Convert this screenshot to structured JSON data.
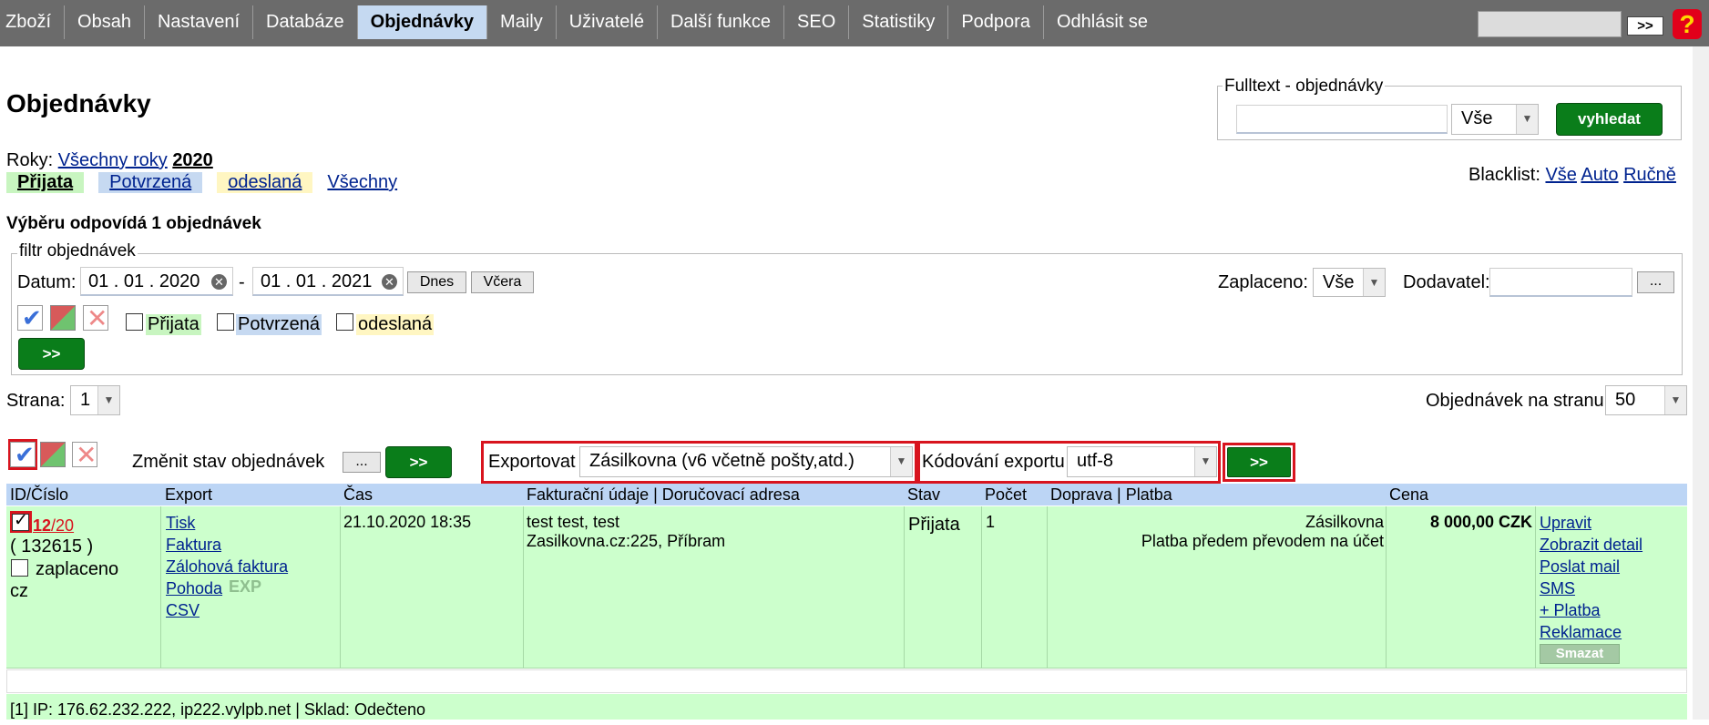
{
  "nav": {
    "items": [
      "Zboží",
      "Obsah",
      "Nastavení",
      "Databáze",
      "Objednávky",
      "Maily",
      "Uživatelé",
      "Další funkce",
      "SEO",
      "Statistiky",
      "Podpora",
      "Odhlásit se"
    ],
    "active": "Objednávky",
    "go_label": ">>",
    "help_label": "?"
  },
  "page_title": "Objednávky",
  "fulltext": {
    "legend": "Fulltext - objednávky",
    "query": "",
    "select_value": "Vše",
    "button_label": "vyhledat"
  },
  "years": {
    "label": "Roky:",
    "all_link": "Všechny roky",
    "current": "2020"
  },
  "status_links": {
    "prijata": "Přijata",
    "potvrzena": "Potvrzená",
    "odeslana": "odeslaná",
    "vsechny": "Všechny"
  },
  "blacklist": {
    "label": "Blacklist:",
    "vse": "Vše",
    "auto": "Auto",
    "rucne": "Ručně"
  },
  "result_count": "Výběru odpovídá 1 objednávek",
  "filter": {
    "legend": "filtr objednávek",
    "datum_label": "Datum:",
    "date_from": "01 . 01 . 2020",
    "date_sep": "-",
    "date_to": "01 . 01 . 2021",
    "dnes": "Dnes",
    "vcera": "Včera",
    "zaplaceno_label": "Zaplaceno:",
    "zaplaceno_value": "Vše",
    "dodavatel_label": "Dodavatel:",
    "dodavatel_value": "",
    "dodavatel_btn": "...",
    "status_prijata": "Přijata",
    "status_potvrzena": "Potvrzená",
    "status_odeslana": "odeslaná",
    "submit": ">>"
  },
  "paging": {
    "strana_label": "Strana:",
    "strana_value": "1",
    "per_page_label": "Objednávek na stranu:",
    "per_page_value": "50"
  },
  "bulk": {
    "change_state_label": "Změnit stav objednávek",
    "dots": "...",
    "go": ">>",
    "export_label": "Exportovat",
    "export_value": "Zásilkovna (v6 včetně pošty,atd.)",
    "encoding_label": "Kódování exportu",
    "encoding_value": "utf-8",
    "export_go": ">>"
  },
  "table": {
    "headers": [
      "ID/Číslo",
      "Export",
      "Čas",
      "Fakturační údaje | Doručovací adresa",
      "Stav",
      "Počet",
      "Doprava | Platba",
      "Cena"
    ],
    "row": {
      "order_no_a": "12",
      "order_no_b": "/20",
      "order_id": "( 132615 )",
      "paid_label": "zaplaceno",
      "lang": "cz",
      "export_links": [
        "Tisk",
        "Faktura",
        "Zálohová faktura",
        "Pohoda",
        "CSV"
      ],
      "exp_badge": "EXP",
      "time": "21.10.2020 18:35",
      "billing_line1": "test test, test",
      "billing_line2": "Zasilkovna.cz:225, Příbram",
      "state": "Přijata",
      "count": "1",
      "shipping": "Zásilkovna",
      "payment": "Platba předem převodem na účet",
      "price": "8 000,00 CZK",
      "actions": [
        "Upravit",
        "Zobrazit detail",
        "Poslat mail",
        "SMS",
        "+ Platba",
        "Reklamace"
      ],
      "delete_label": "Smazat",
      "footer": "[1]   IP: 176.62.232.222, ip222.vylpb.net | Sklad: Odečteno"
    }
  },
  "colors": {
    "accent_green": "#0a7d1a",
    "nav_bg": "#6b6b6b",
    "row_green": "#ccffcc",
    "header_blue": "#bcd5f5",
    "highlight_red": "#d8141e"
  }
}
